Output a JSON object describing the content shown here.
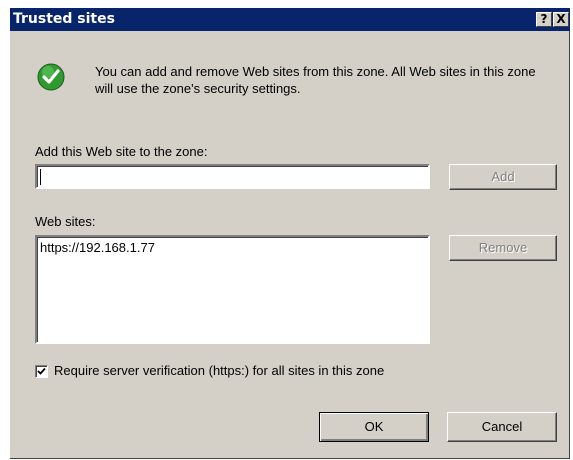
{
  "window": {
    "title": "Trusted sites",
    "help_button": "?",
    "close_button": "X"
  },
  "info": {
    "icon": "green-check-icon",
    "text": "You can add and remove Web sites from this zone. All Web sites in this zone will use the zone's security settings."
  },
  "add_site": {
    "label": "Add this Web site to the zone:",
    "value": "",
    "button": "Add"
  },
  "web_sites": {
    "label": "Web sites:",
    "items": [
      "https://192.168.1.77"
    ],
    "remove_button": "Remove"
  },
  "require_verification": {
    "checked": true,
    "label": "Require server verification (https:) for all sites in this zone"
  },
  "footer": {
    "ok": "OK",
    "cancel": "Cancel"
  },
  "colors": {
    "titlebar": "#08246b",
    "face": "#d4d0c8",
    "check_green": "#2f9a2f"
  }
}
